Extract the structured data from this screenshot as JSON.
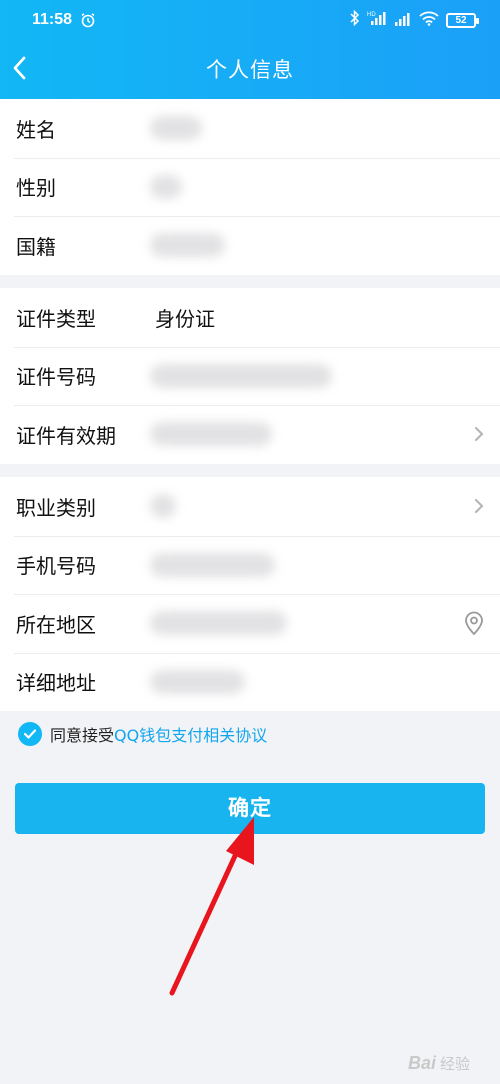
{
  "status_bar": {
    "time": "11:58",
    "battery": "52"
  },
  "header": {
    "title": "个人信息"
  },
  "groups": [
    {
      "rows": [
        {
          "label": "姓名",
          "value": ""
        },
        {
          "label": "性别",
          "value": ""
        },
        {
          "label": "国籍",
          "value": ""
        }
      ]
    },
    {
      "rows": [
        {
          "label": "证件类型",
          "value": "身份证"
        },
        {
          "label": "证件号码",
          "value": ""
        },
        {
          "label": "证件有效期",
          "value": ""
        }
      ]
    },
    {
      "rows": [
        {
          "label": "职业类别",
          "value": ""
        },
        {
          "label": "手机号码",
          "value": ""
        },
        {
          "label": "所在地区",
          "value": ""
        },
        {
          "label": "详细地址",
          "value": ""
        }
      ]
    }
  ],
  "agreement": {
    "prefix": "同意接受",
    "link": "QQ钱包支付相关协议",
    "checked": true
  },
  "confirm_button": {
    "label": "确定"
  },
  "watermark": {
    "text": "Bai",
    "suffix": "经验"
  },
  "colors": {
    "header": "#12b7f5",
    "button": "#18b4f0",
    "link": "#12a6ee",
    "annotation_arrow": "#e8141e"
  }
}
